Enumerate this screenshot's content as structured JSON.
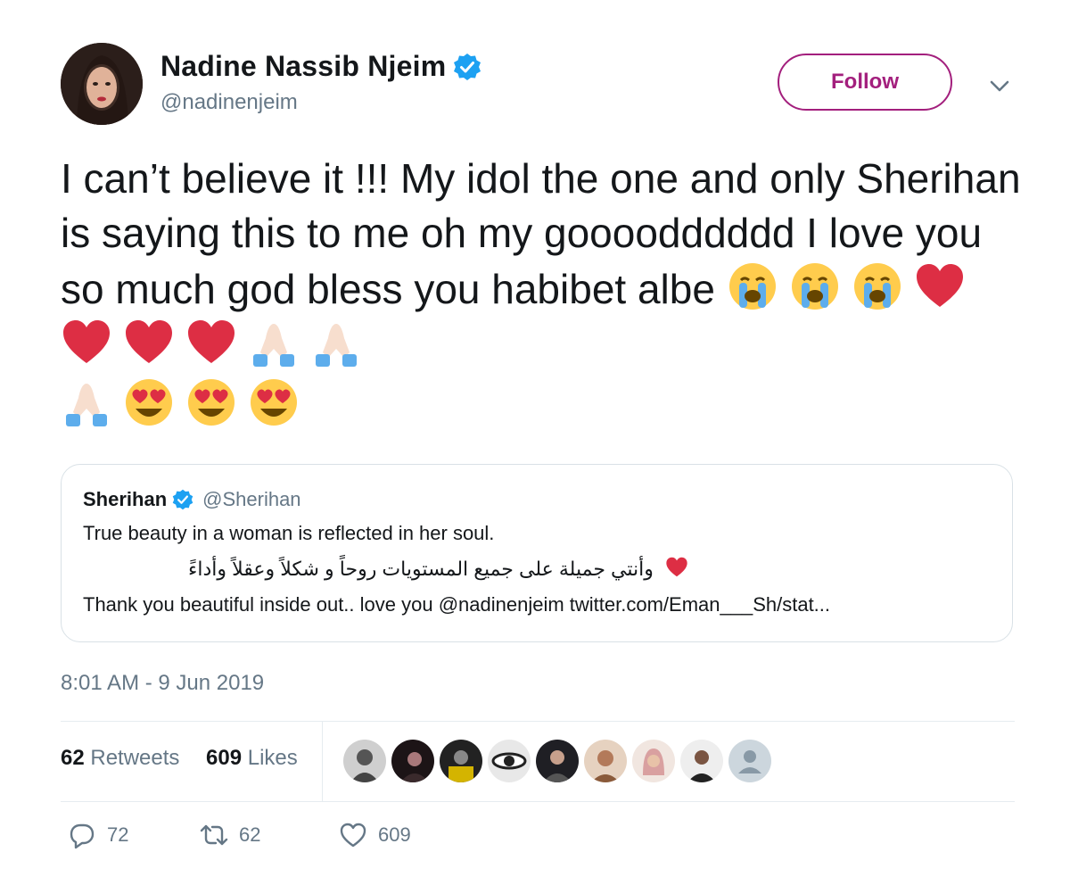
{
  "author": {
    "display_name": "Nadine Nassib Njeim",
    "handle": "@nadinenjeim",
    "verified": true,
    "follow_label": "Follow"
  },
  "tweet": {
    "text": "I can’t believe it !!! My idol the one and only Sherihan is saying this to me oh my goooodddddd I love you so much god bless you habibet albe",
    "emojis": [
      "loudly-crying-face",
      "loudly-crying-face",
      "loudly-crying-face",
      "red-heart",
      "red-heart",
      "red-heart",
      "red-heart",
      "folded-hands",
      "folded-hands",
      "folded-hands",
      "heart-eyes-face",
      "heart-eyes-face",
      "heart-eyes-face"
    ]
  },
  "quote": {
    "name": "Sherihan",
    "handle": "@Sherihan",
    "verified": true,
    "line1": "True beauty in a woman is reflected in her soul.",
    "line2": "وأنتي جميلة على جميع المستويات روحاً و شكلاً وعقلاً وأداءً",
    "line3": "Thank you beautiful inside out.. love you @nadinenjeim twitter.com/Eman___Sh/stat..."
  },
  "timestamp": "8:01 AM - 9 Jun 2019",
  "stats": {
    "retweets_count": "62",
    "retweets_label": "Retweets",
    "likes_count": "609",
    "likes_label": "Likes"
  },
  "actions": {
    "reply_count": "72",
    "retweet_count": "62",
    "like_count": "609"
  },
  "colors": {
    "follow_accent": "#a31f7d",
    "verified_blue": "#1da1f2",
    "secondary_text": "#657786"
  }
}
